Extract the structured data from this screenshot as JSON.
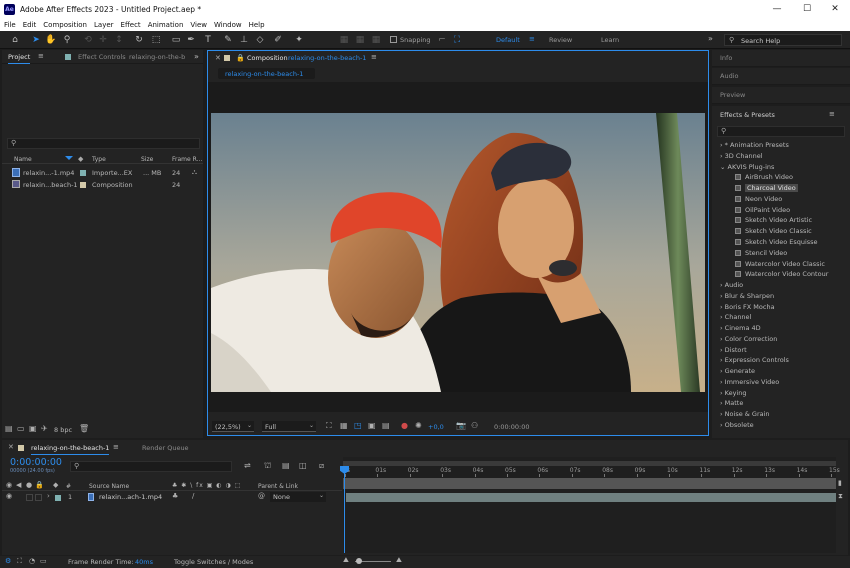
{
  "window": {
    "title": "Adobe After Effects 2023 - Untitled Project.aep *",
    "app_icon": "Ae",
    "minimize": "—",
    "maximize": "☐",
    "close": "✕"
  },
  "menu": [
    "File",
    "Edit",
    "Composition",
    "Layer",
    "Effect",
    "Animation",
    "View",
    "Window",
    "Help"
  ],
  "toolbar": {
    "snapping": "Snapping",
    "workspaces": [
      "Default",
      "Review",
      "Learn"
    ],
    "search_placeholder": "Search Help"
  },
  "project_panel": {
    "tabs": [
      "Project",
      "Effect Controls",
      "relaxing-on-the-b"
    ],
    "search_placeholder": "",
    "columns": [
      "Name",
      "Type",
      "Size",
      "Frame R..."
    ],
    "items": [
      {
        "name": "relaxin...-1.mp4",
        "type": "Importe...EX",
        "size": "... MB",
        "fps": "24"
      },
      {
        "name": "relaxin...beach-1",
        "type": "Composition",
        "size": "",
        "fps": "24"
      }
    ],
    "bpc": "8 bpc"
  },
  "composition_panel": {
    "tab_label": "Composition",
    "comp_name": "relaxing-on-the-beach-1",
    "sub_tab": "relaxing-on-the-beach-1",
    "zoom": "(22,5%)",
    "resolution": "Full",
    "exposure": "+0,0",
    "timecode": "0:00:00:00"
  },
  "right_panels": {
    "collapsed": [
      "Info",
      "Audio",
      "Preview"
    ],
    "effects_title": "Effects & Presets",
    "categories_top": [
      "* Animation Presets",
      "3D Channel",
      "AKVIS Plug-ins"
    ],
    "akvis": [
      "AirBrush Video",
      "Charcoal Video",
      "Neon Video",
      "OilPaint Video",
      "Sketch Video Artistic",
      "Sketch Video Classic",
      "Sketch Video Esquisse",
      "Stencil Video",
      "Watercolor Video Classic",
      "Watercolor Video Contour"
    ],
    "selected_plugin": "Charcoal Video",
    "categories_bottom": [
      "Audio",
      "Blur & Sharpen",
      "Boris FX Mocha",
      "Channel",
      "Cinema 4D",
      "Color Correction",
      "Distort",
      "Expression Controls",
      "Generate",
      "Immersive Video",
      "Keying",
      "Matte",
      "Noise & Grain",
      "Obsolete"
    ]
  },
  "timeline": {
    "tabs": [
      "relaxing-on-the-beach-1",
      "Render Queue"
    ],
    "timecode": "0:00:00:00",
    "frame_info": "00000 (24.00 fps)",
    "columns": {
      "num": "#",
      "source": "Source Name",
      "parent": "Parent & Link"
    },
    "layer": {
      "num": "1",
      "name": "relaxin...ach-1.mp4",
      "parent": "None"
    },
    "ruler": [
      "0s",
      "01s",
      "02s",
      "03s",
      "04s",
      "05s",
      "06s",
      "07s",
      "08s",
      "09s",
      "10s",
      "11s",
      "12s",
      "13s",
      "14s",
      "15s"
    ],
    "render_time_label": "Frame Render Time:",
    "render_time": "40ms",
    "toggle": "Toggle Switches / Modes"
  },
  "colors": {
    "accent": "#2d8ceb",
    "panel": "#232323",
    "bg": "#1d1d1d",
    "layer_bar": "#6f8080"
  }
}
